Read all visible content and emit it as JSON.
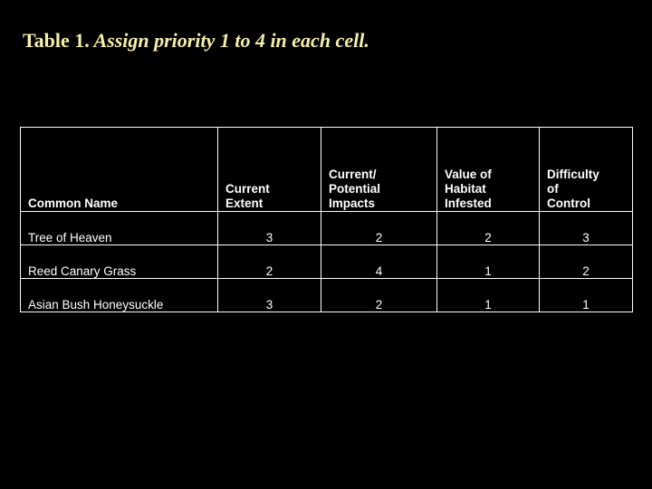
{
  "slide": {
    "title_lead": "Table 1.",
    "title_rest": " Assign priority 1 to 4 in each cell.",
    "background_color": "#000000",
    "title_color": "#f5f0a8",
    "text_color": "#ffffff"
  },
  "table": {
    "headers": [
      "Common Name",
      "Current Extent",
      "Current/ Potential Impacts",
      "Value of Habitat Infested",
      "Difficulty of Control"
    ],
    "header_lines": [
      [
        "Common Name"
      ],
      [
        "Current",
        "Extent"
      ],
      [
        "Current/",
        "Potential",
        "Impacts"
      ],
      [
        "Value of",
        "Habitat",
        "Infested"
      ],
      [
        "Difficulty",
        "of",
        "Control"
      ]
    ],
    "rows": [
      {
        "name": "Tree of Heaven",
        "current_extent": "3",
        "impacts": "2",
        "habitat_value": "2",
        "difficulty": "3"
      },
      {
        "name": "Reed Canary Grass",
        "current_extent": "2",
        "impacts": "4",
        "habitat_value": "1",
        "difficulty": "2"
      },
      {
        "name": "Asian Bush Honeysuckle",
        "current_extent": "3",
        "impacts": "2",
        "habitat_value": "1",
        "difficulty": "1"
      }
    ]
  }
}
